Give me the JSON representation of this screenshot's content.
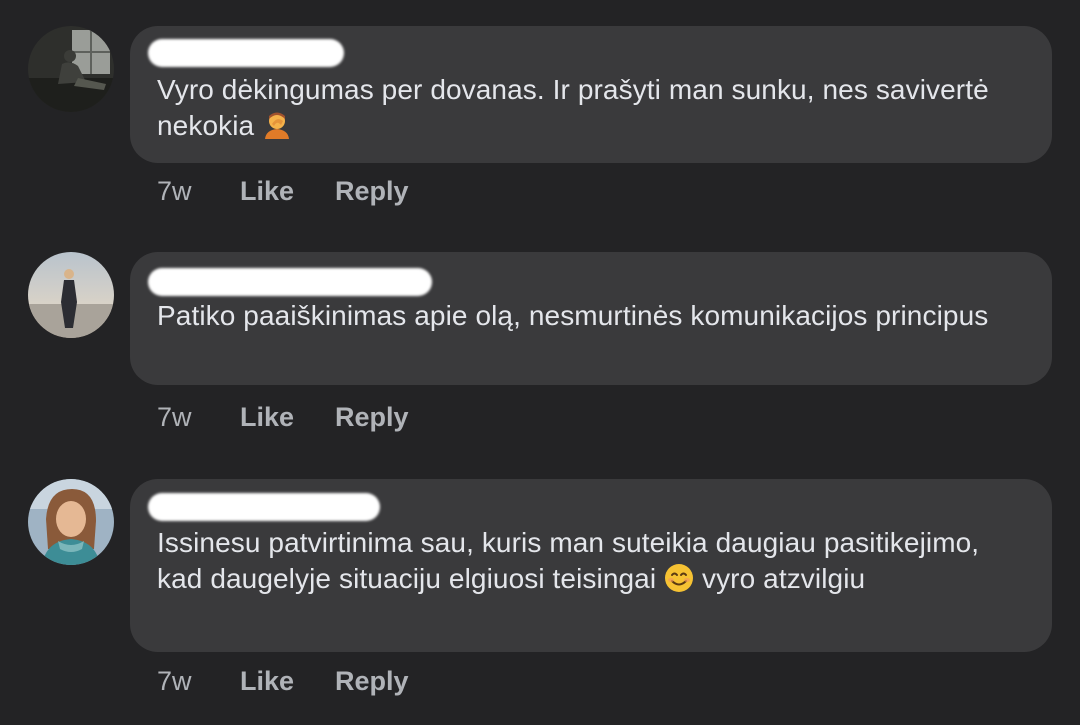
{
  "comments": [
    {
      "author": "",
      "text": "Vyro dėkingumas per dovanas. Ir prašyti man sunku, nes savivertė nekokia",
      "emoji": "person-facepalming",
      "time": "7w",
      "like_label": "Like",
      "reply_label": "Reply"
    },
    {
      "author": "",
      "text": "Patiko paaiškinimas apie olą, nesmurtinės komunikacijos principus",
      "time": "7w",
      "like_label": "Like",
      "reply_label": "Reply"
    },
    {
      "author": "",
      "text_before_emoji": "Issinesu patvirtinima sau, kuris man suteikia daugiau pasitikejimo, kad daugelyje situaciju elgiuosi teisingai",
      "emoji": "smiling-face-with-smiling-eyes",
      "text_after_emoji": "vyro atzvilgiu",
      "time": "7w",
      "like_label": "Like",
      "reply_label": "Reply"
    }
  ],
  "colors": {
    "background": "#232325",
    "bubble": "#3a3a3c",
    "text": "#e4e6eb",
    "secondary_text": "#b0b3b8",
    "name_redaction": "#ffffff"
  }
}
